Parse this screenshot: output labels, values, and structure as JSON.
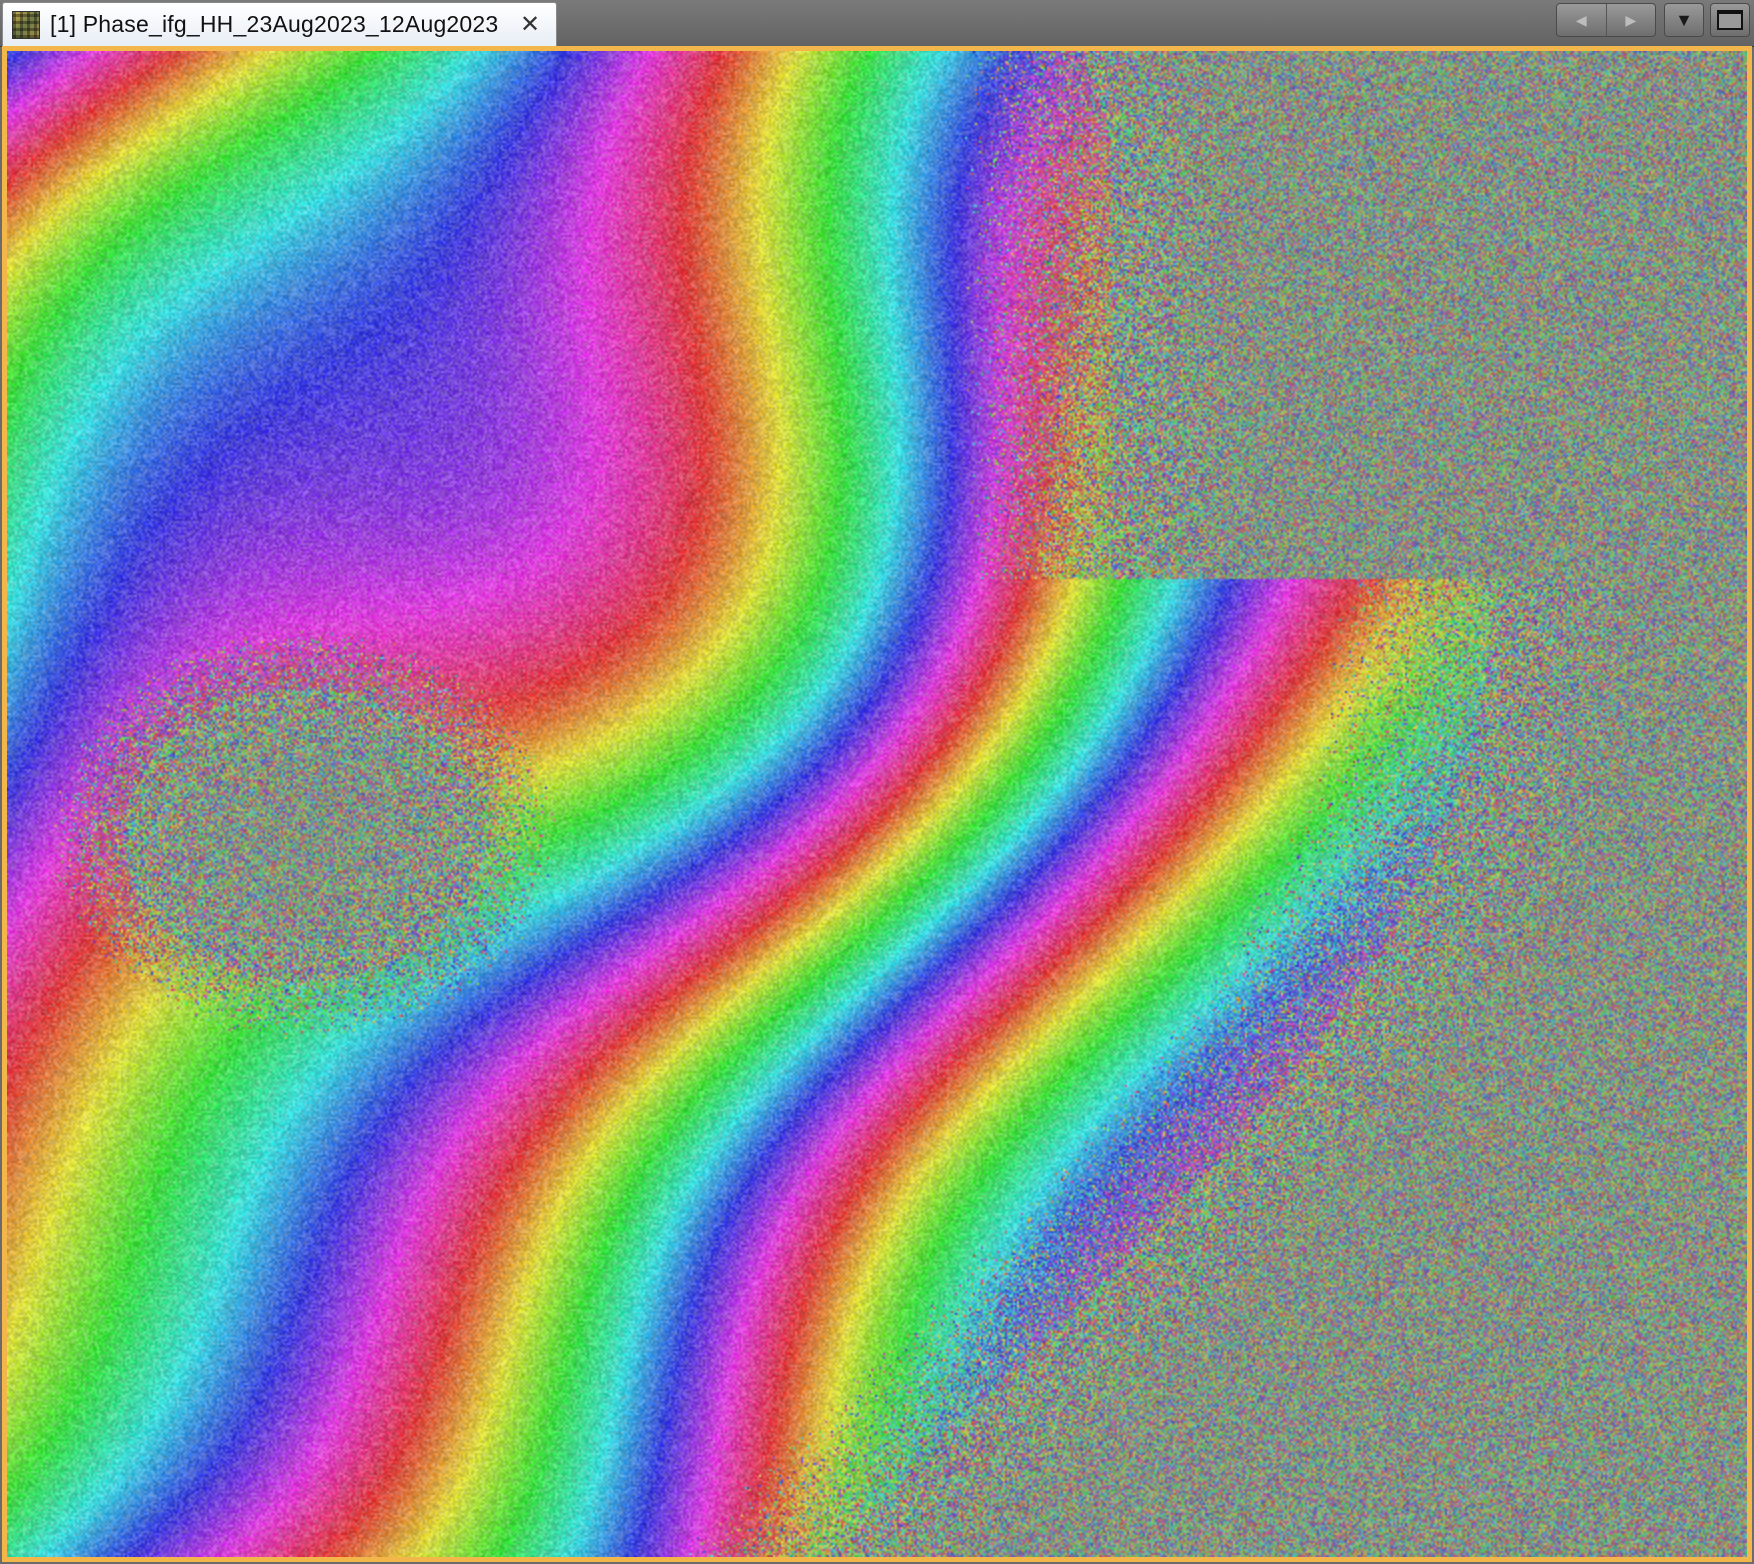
{
  "window": {
    "tab": {
      "title": "[1] Phase_ifg_HH_23Aug2023_12Aug2023",
      "icon": "raster-band-icon",
      "close_symbol": "✕"
    },
    "toolbar": {
      "prev_symbol": "◀",
      "next_symbol": "▶",
      "dropdown_symbol": "▼"
    }
  },
  "view": {
    "content": "interferometric phase image",
    "colormap": "cyclic rainbow (magenta, red, orange, yellow, green, cyan, blue)",
    "frame_color": "#f2b64a"
  }
}
